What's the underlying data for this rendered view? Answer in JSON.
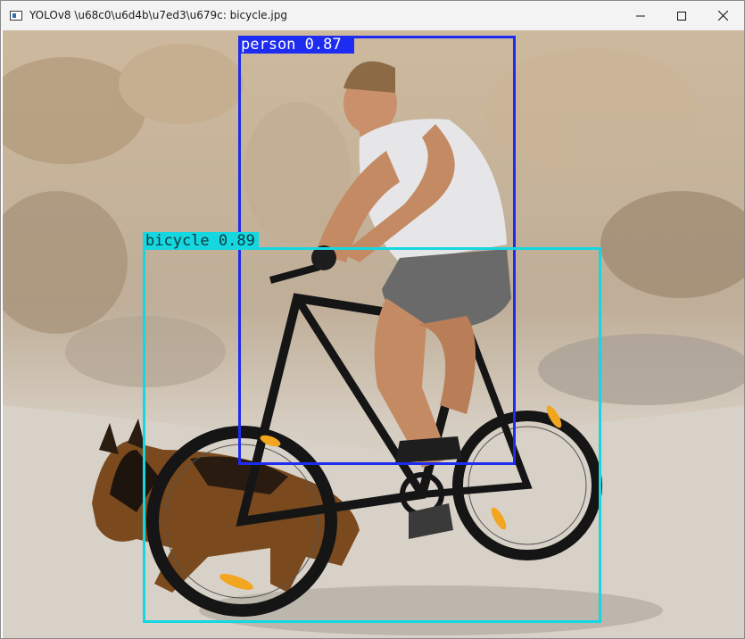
{
  "window": {
    "title": "YOLOv8 \\u68c0\\u6d4b\\u7ed3\\u679c: bicycle.jpg"
  },
  "controls": {
    "minimize_icon": "minimize-icon",
    "maximize_icon": "maximize-icon",
    "close_icon": "close-icon"
  },
  "detections": [
    {
      "label": "person 0.87",
      "color": "#1e2bf0"
    },
    {
      "label": "bicycle 0.89",
      "color": "#16d6e0"
    }
  ],
  "colors": {
    "titlebar": "#f3f3f3",
    "sky": "#d9cdb8",
    "rock": "#b9a489",
    "ground": "#c9c1b6"
  }
}
